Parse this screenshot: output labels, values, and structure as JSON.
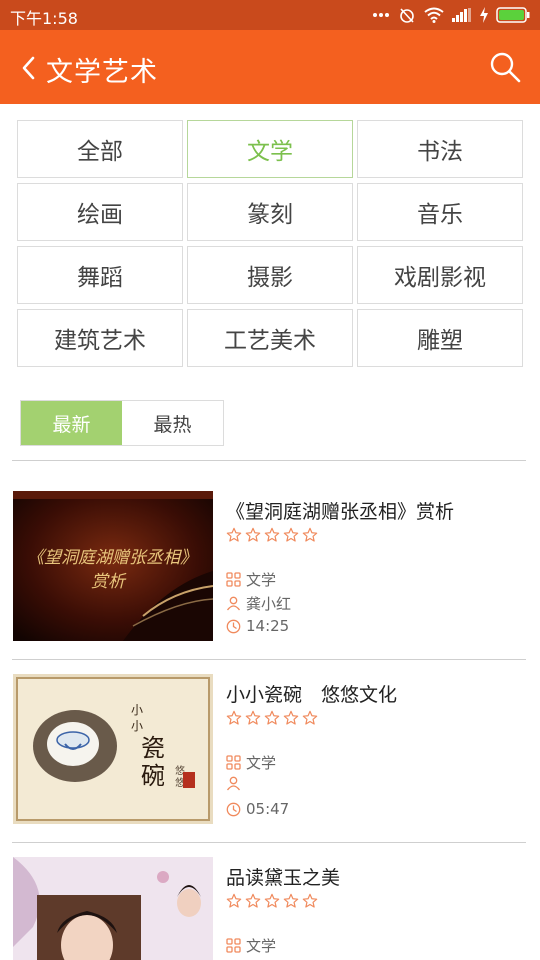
{
  "status_bar": {
    "time": "下午1:58",
    "icons": [
      "more-dots-icon",
      "alarm-off-icon",
      "wifi-icon",
      "signal-icon",
      "charging-icon",
      "battery-icon"
    ]
  },
  "app_bar": {
    "title": "文学艺术",
    "back_icon": "chevron-left-icon",
    "search_icon": "search-icon",
    "color": "#f4601f"
  },
  "categories": [
    {
      "label": "全部",
      "selected": false
    },
    {
      "label": "文学",
      "selected": true
    },
    {
      "label": "书法",
      "selected": false
    },
    {
      "label": "绘画",
      "selected": false
    },
    {
      "label": "篆刻",
      "selected": false
    },
    {
      "label": "音乐",
      "selected": false
    },
    {
      "label": "舞蹈",
      "selected": false
    },
    {
      "label": "摄影",
      "selected": false
    },
    {
      "label": "戏剧影视",
      "selected": false
    },
    {
      "label": "建筑艺术",
      "selected": false
    },
    {
      "label": "工艺美术",
      "selected": false
    },
    {
      "label": "雕塑",
      "selected": false
    }
  ],
  "sort_tabs": [
    {
      "label": "最新",
      "selected": true
    },
    {
      "label": "最热",
      "selected": false
    }
  ],
  "items": [
    {
      "title": "《望洞庭湖赠张丞相》赏析",
      "rating": 0,
      "category": "文学",
      "author": "龚小红",
      "duration": "14:25"
    },
    {
      "title": "小小瓷碗　悠悠文化",
      "rating": 0,
      "category": "文学",
      "author": "",
      "duration": "05:47"
    },
    {
      "title": "品读黛玉之美",
      "rating": 0,
      "category": "文学",
      "author": "",
      "duration": ""
    }
  ],
  "colors": {
    "accent": "#f4601f",
    "status_bar": "#c94a1c",
    "selected_green": "#7cc04d",
    "tab_green": "#a3d170",
    "star": "#f08a5d"
  }
}
